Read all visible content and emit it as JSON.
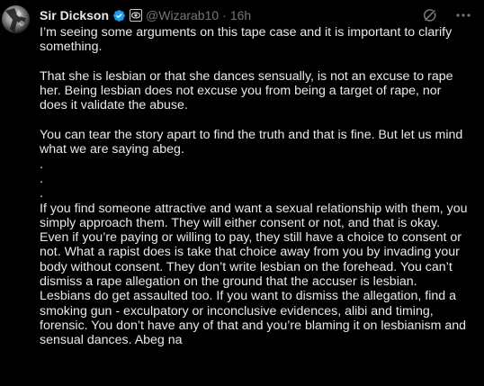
{
  "tweet": {
    "display_name": "Sir Dickson",
    "handle": "@Wizarab10",
    "separator": "·",
    "time": "16h",
    "body": "I’m seeing some arguments on this tape case and it is important to clarify something.\n\nThat she is lesbian or that she dances sensually, is not an excuse to rape her. Being lesbian does not excuse you from being a target of rape, nor does it validate the abuse.\n\nYou can tear the story apart to find the truth and that is fine. But let us mind what we are saying abeg.\n.\n.\n.\nIf you find someone attractive and want a sexual relationship with them, you simply approach them. They will either consent or not, and that is okay. Even if you’re paying or willing to pay, they still have a choice to consent or not. What a rapist does is take that choice away from you by invading your body without consent. They don’t write lesbian on the forehead. You can’t dismiss a rape allegation on the ground that the accuser is lesbian. Lesbians do get assaulted too. If you want to dismiss the allegation, find a smoking gun - exculpatory or inconclusive evidences, alibi and timing, forensic. You don’t have any of that and you’re blaming it on lesbianism and sensual dances. Abeg na"
  },
  "icons": {
    "avatar": "avatar",
    "verified": "verified-badge-icon",
    "affiliation": "affiliation-badge-icon",
    "grok": "grok-icon",
    "more": "more-icon"
  },
  "colors": {
    "background": "#000000",
    "text": "#e7e9ea",
    "secondary": "#71767b",
    "verified_blue": "#1d9bf0"
  }
}
